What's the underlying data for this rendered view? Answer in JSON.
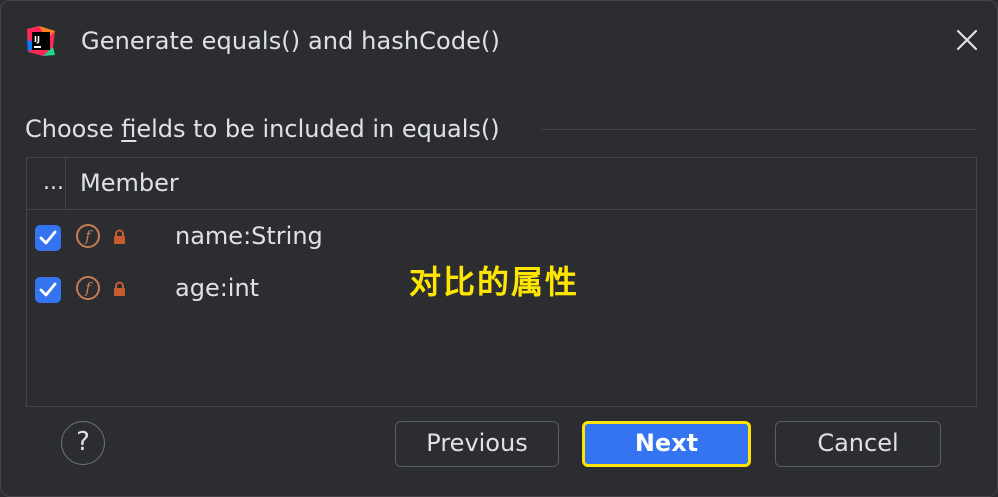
{
  "dialog": {
    "title": "Generate equals() and hashCode()",
    "icons": {
      "app": "intellij-idea-logo-icon",
      "close": "close-icon"
    }
  },
  "section": {
    "label_before": "Choose ",
    "label_mnemonic": "f",
    "label_after": "ields to be included in equals()"
  },
  "table": {
    "columns": [
      "...",
      "Member"
    ],
    "rows": [
      {
        "checked": true,
        "field_icon_letter": "f",
        "icon": "field-icon",
        "lock": "lock-icon",
        "label": "name:String"
      },
      {
        "checked": true,
        "field_icon_letter": "f",
        "icon": "field-icon",
        "lock": "lock-icon",
        "label": "age:int"
      }
    ]
  },
  "annotation": {
    "text": "对比的属性",
    "color": "#ffe600"
  },
  "footer": {
    "help_label": "?",
    "previous_label": "Previous",
    "next_label": "Next",
    "cancel_label": "Cancel"
  },
  "colors": {
    "background": "#2b2d30",
    "accent": "#3574f0",
    "highlight": "#ffe600",
    "field_icon": "#c77d55"
  }
}
